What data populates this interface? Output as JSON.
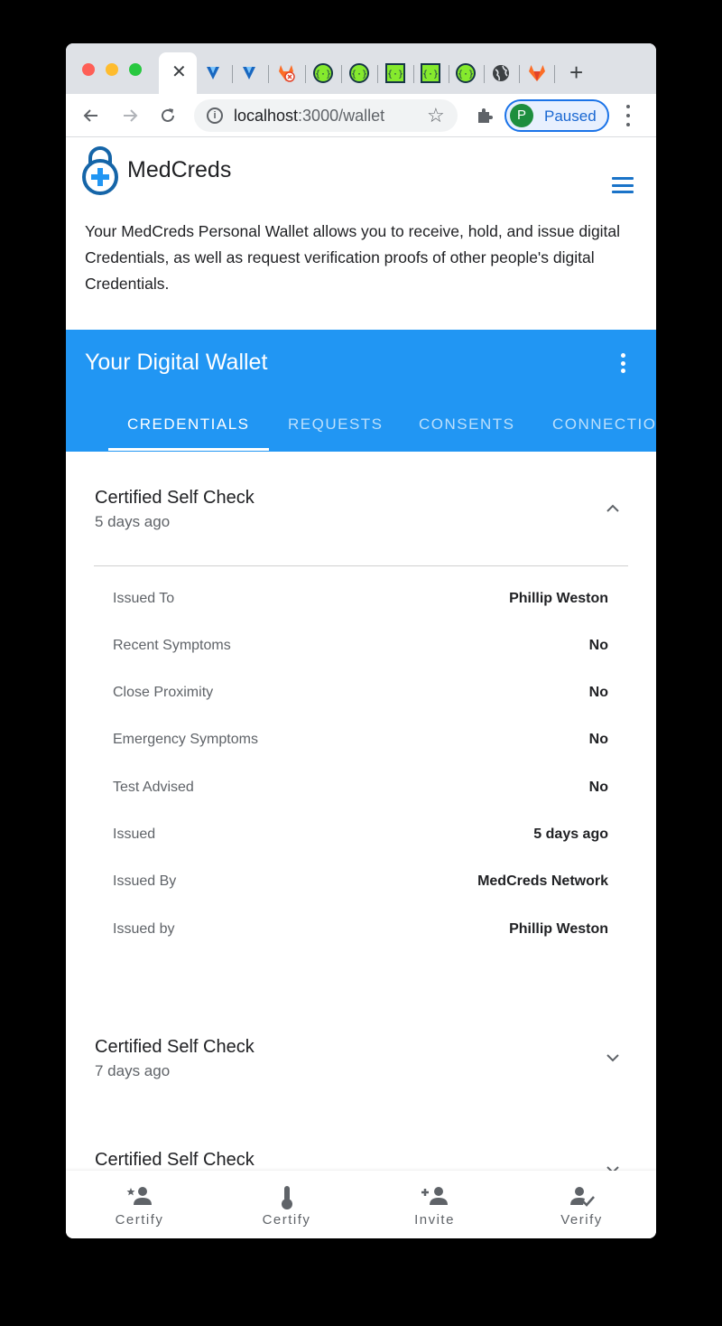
{
  "browser": {
    "url_host": "localhost",
    "url_path": ":3000/wallet",
    "profile_initial": "P",
    "profile_label": "Paused",
    "tab_favicons": [
      "vuetify-icon",
      "vuetify-icon",
      "gitlab-error-icon",
      "api-icon",
      "api-icon",
      "api-icon",
      "api-icon",
      "api-icon",
      "globe-icon",
      "gitlab-icon"
    ]
  },
  "app": {
    "brand": "MedCreds",
    "intro": "Your MedCreds Personal Wallet allows you to receive, hold, and issue digital Credentials, as well as request verification proofs of other people's digital Credentials."
  },
  "wallet": {
    "title": "Your Digital Wallet",
    "tabs": [
      "CREDENTIALS",
      "REQUESTS",
      "CONSENTS",
      "CONNECTIONS"
    ],
    "active_tab": "CREDENTIALS"
  },
  "credentials": [
    {
      "title": "Certified Self Check",
      "time": "5 days ago",
      "expanded": true,
      "details": [
        {
          "label": "Issued To",
          "value": "Phillip Weston"
        },
        {
          "label": "Recent Symptoms",
          "value": "No"
        },
        {
          "label": "Close Proximity",
          "value": "No"
        },
        {
          "label": "Emergency Symptoms",
          "value": "No"
        },
        {
          "label": "Test Advised",
          "value": "No"
        },
        {
          "label": "Issued",
          "value": "5 days ago"
        },
        {
          "label": "Issued By",
          "value": "MedCreds Network"
        },
        {
          "label": "Issued by",
          "value": "Phillip Weston"
        }
      ]
    },
    {
      "title": "Certified Self Check",
      "time": "7 days ago",
      "expanded": false
    },
    {
      "title": "Certified Self Check",
      "expanded": false
    }
  ],
  "bottom_nav": [
    {
      "label": "Certify",
      "icon": "person-star-icon"
    },
    {
      "label": "Certify",
      "icon": "thermometer-icon"
    },
    {
      "label": "Invite",
      "icon": "person-add-icon"
    },
    {
      "label": "Verify",
      "icon": "person-check-icon"
    }
  ],
  "colors": {
    "primary": "#2196f3",
    "logo": "#1565a8",
    "text": "#202124"
  }
}
